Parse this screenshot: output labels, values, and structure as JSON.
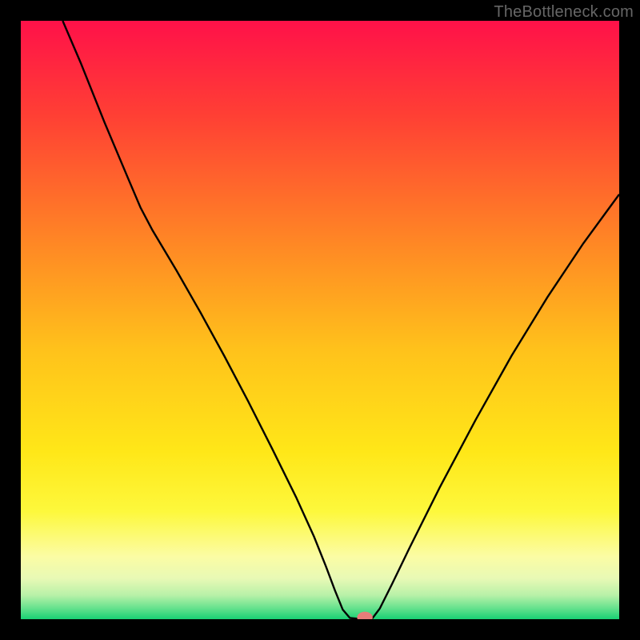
{
  "watermark": "TheBottleneck.com",
  "chart_data": {
    "type": "line",
    "title": "",
    "xlabel": "",
    "ylabel": "",
    "xlim": [
      0,
      100
    ],
    "ylim": [
      0,
      100
    ],
    "background_gradient_stops": [
      {
        "offset": 0.0,
        "color": "#ff1149"
      },
      {
        "offset": 0.16,
        "color": "#ff4034"
      },
      {
        "offset": 0.38,
        "color": "#ff8a24"
      },
      {
        "offset": 0.55,
        "color": "#ffc21b"
      },
      {
        "offset": 0.72,
        "color": "#ffe718"
      },
      {
        "offset": 0.82,
        "color": "#fdf83c"
      },
      {
        "offset": 0.895,
        "color": "#fbfca4"
      },
      {
        "offset": 0.932,
        "color": "#e8f9b5"
      },
      {
        "offset": 0.96,
        "color": "#b8f1a8"
      },
      {
        "offset": 0.982,
        "color": "#64e18d"
      },
      {
        "offset": 1.0,
        "color": "#18d074"
      }
    ],
    "series": [
      {
        "name": "bottleneck-curve",
        "color": "#000000",
        "width": 2.4,
        "points": [
          {
            "x": 7.0,
            "y": 100.0
          },
          {
            "x": 10.0,
            "y": 93.0
          },
          {
            "x": 14.0,
            "y": 83.0
          },
          {
            "x": 18.0,
            "y": 73.5
          },
          {
            "x": 20.0,
            "y": 68.8
          },
          {
            "x": 22.0,
            "y": 65.0
          },
          {
            "x": 26.0,
            "y": 58.3
          },
          {
            "x": 30.0,
            "y": 51.3
          },
          {
            "x": 34.0,
            "y": 44.0
          },
          {
            "x": 38.0,
            "y": 36.4
          },
          {
            "x": 42.0,
            "y": 28.5
          },
          {
            "x": 46.0,
            "y": 20.4
          },
          {
            "x": 49.0,
            "y": 13.8
          },
          {
            "x": 51.0,
            "y": 8.8
          },
          {
            "x": 52.5,
            "y": 4.8
          },
          {
            "x": 53.8,
            "y": 1.6
          },
          {
            "x": 55.0,
            "y": 0.2
          },
          {
            "x": 57.0,
            "y": 0.0
          },
          {
            "x": 58.8,
            "y": 0.2
          },
          {
            "x": 60.0,
            "y": 1.8
          },
          {
            "x": 62.0,
            "y": 5.8
          },
          {
            "x": 65.0,
            "y": 12.0
          },
          {
            "x": 70.0,
            "y": 22.0
          },
          {
            "x": 76.0,
            "y": 33.3
          },
          {
            "x": 82.0,
            "y": 44.0
          },
          {
            "x": 88.0,
            "y": 53.8
          },
          {
            "x": 94.0,
            "y": 62.8
          },
          {
            "x": 100.0,
            "y": 71.0
          }
        ]
      }
    ],
    "marker": {
      "x": 57.5,
      "y": 0.3,
      "rx": 1.3,
      "ry": 0.95,
      "fill": "#e77d7a"
    }
  }
}
